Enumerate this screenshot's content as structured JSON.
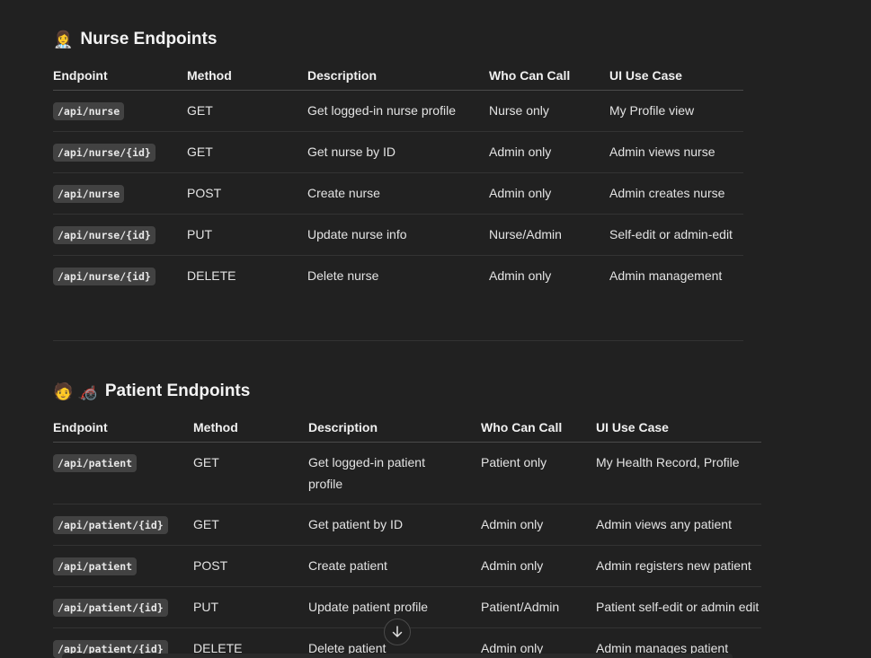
{
  "nurse": {
    "emoji": "👩‍⚕️",
    "title": "Nurse Endpoints",
    "headers": [
      "Endpoint",
      "Method",
      "Description",
      "Who Can Call",
      "UI Use Case"
    ],
    "rows": [
      {
        "endpoint": "/api/nurse",
        "method": "GET",
        "description": "Get logged-in nurse profile",
        "who": "Nurse only",
        "use_case": "My Profile view"
      },
      {
        "endpoint": "/api/nurse/{id}",
        "method": "GET",
        "description": "Get nurse by ID",
        "who": "Admin only",
        "use_case": "Admin views nurse"
      },
      {
        "endpoint": "/api/nurse",
        "method": "POST",
        "description": "Create nurse",
        "who": "Admin only",
        "use_case": "Admin creates nurse"
      },
      {
        "endpoint": "/api/nurse/{id}",
        "method": "PUT",
        "description": "Update nurse info",
        "who": "Nurse/Admin",
        "use_case": "Self-edit or admin-edit"
      },
      {
        "endpoint": "/api/nurse/{id}",
        "method": "DELETE",
        "description": "Delete nurse",
        "who": "Admin only",
        "use_case": "Admin management"
      }
    ]
  },
  "patient": {
    "emoji": "🧑 🦽",
    "title": "Patient Endpoints",
    "headers": [
      "Endpoint",
      "Method",
      "Description",
      "Who Can Call",
      "UI Use Case"
    ],
    "rows": [
      {
        "endpoint": "/api/patient",
        "method": "GET",
        "description": "Get logged-in patient profile",
        "who": "Patient only",
        "use_case": "My Health Record, Profile"
      },
      {
        "endpoint": "/api/patient/{id}",
        "method": "GET",
        "description": "Get patient by ID",
        "who": "Admin only",
        "use_case": "Admin views any patient"
      },
      {
        "endpoint": "/api/patient",
        "method": "POST",
        "description": "Create patient",
        "who": "Admin only",
        "use_case": "Admin registers new patient"
      },
      {
        "endpoint": "/api/patient/{id}",
        "method": "PUT",
        "description": "Update patient profile",
        "who": "Patient/Admin",
        "use_case": "Patient self-edit or admin edit"
      },
      {
        "endpoint": "/api/patient/{id}",
        "method": "DELETE",
        "description": "Delete patient",
        "who": "Admin only",
        "use_case": "Admin manages patient"
      }
    ]
  },
  "icons": {
    "scroll_down": "arrow-down-icon"
  }
}
